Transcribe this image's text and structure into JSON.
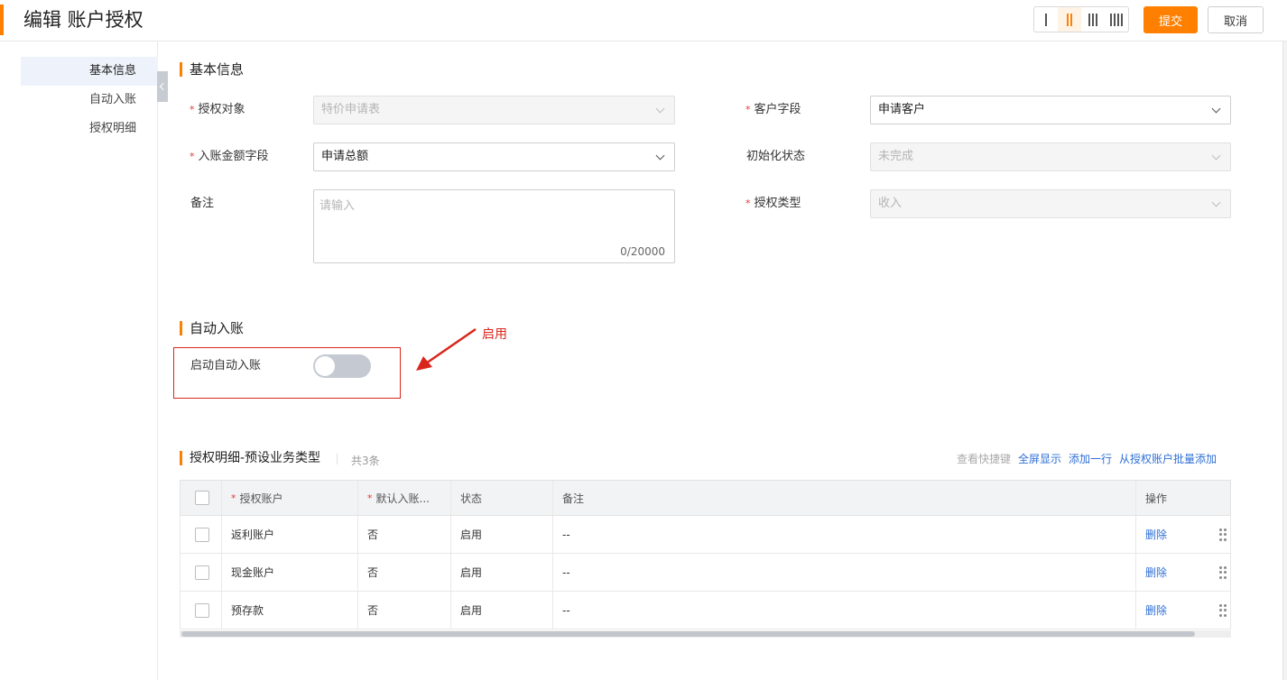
{
  "header": {
    "title": "编辑 账户授权",
    "submit_label": "提交",
    "cancel_label": "取消",
    "layout_options": [
      "1-column",
      "2-column",
      "3-column",
      "4-column"
    ],
    "layout_selected": "2-column",
    "accent_color": "#ff8000"
  },
  "sidebar": {
    "items": [
      {
        "label": "基本信息",
        "active": true
      },
      {
        "label": "自动入账",
        "active": false
      },
      {
        "label": "授权明细",
        "active": false
      }
    ]
  },
  "basic": {
    "section_title": "基本信息",
    "auth_object": {
      "label": "授权对象",
      "required": true,
      "value": "特价申请表",
      "disabled": true
    },
    "customer_field": {
      "label": "客户字段",
      "required": true,
      "value": "申请客户",
      "disabled": false
    },
    "amount_field": {
      "label": "入账金额字段",
      "required": true,
      "value": "申请总额",
      "disabled": false
    },
    "init_status": {
      "label": "初始化状态",
      "required": false,
      "value": "未完成",
      "disabled": true
    },
    "remark": {
      "label": "备注",
      "placeholder": "请输入",
      "counter": "0/20000"
    },
    "auth_type": {
      "label": "授权类型",
      "required": true,
      "value": "收入",
      "disabled": true
    }
  },
  "auto": {
    "section_title": "自动入账",
    "toggle_label": "启动自动入账",
    "toggle_on": false,
    "annotation": "启用",
    "annotation_color": "#d9261c"
  },
  "detail": {
    "title": "授权明细-预设业务类型",
    "count": "共3条",
    "actions": [
      "查看快捷键",
      "全屏显示",
      "添加一行",
      "从授权账户批量添加"
    ],
    "columns": [
      "授权账户",
      "默认入账...",
      "状态",
      "备注",
      "操作"
    ],
    "rows": [
      {
        "account": "返利账户",
        "default": "否",
        "status": "启用",
        "remark": "--",
        "op": "删除"
      },
      {
        "account": "现金账户",
        "default": "否",
        "status": "启用",
        "remark": "--",
        "op": "删除"
      },
      {
        "account": "预存款",
        "default": "否",
        "status": "启用",
        "remark": "--",
        "op": "删除"
      }
    ]
  }
}
